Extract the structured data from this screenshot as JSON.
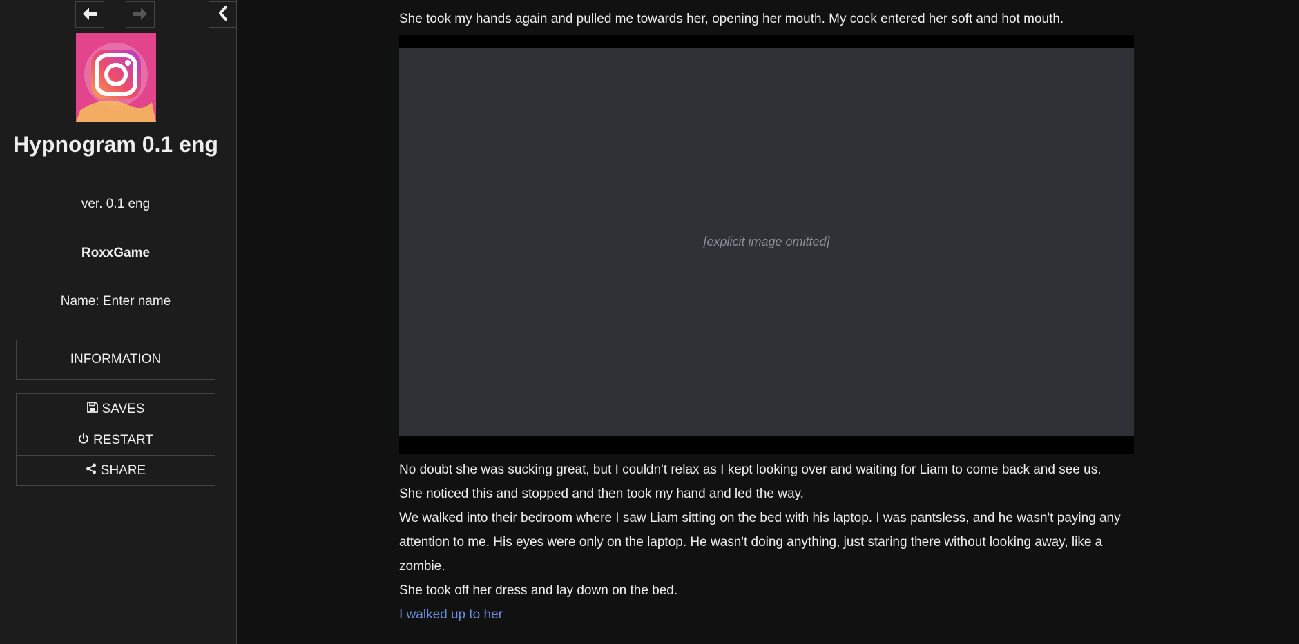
{
  "sidebar": {
    "history_back_icon": "arrow-left-icon",
    "history_forward_icon": "arrow-right-icon",
    "stow_icon": "chevron-left-icon",
    "cover_icon": "instagram-logo-icon",
    "title": "Hypnogram 0.1 eng",
    "version": "ver. 0.1 eng",
    "author": "RoxxGame",
    "name_label": "Name:",
    "name_value": "Enter name",
    "information_label": "INFORMATION",
    "menu": [
      {
        "label": "SAVES",
        "icon": "floppy-disk-icon"
      },
      {
        "label": "RESTART",
        "icon": "power-icon"
      },
      {
        "label": "SHARE",
        "icon": "share-icon"
      }
    ]
  },
  "passage": {
    "intro": "She took my hands again and pulled me towards her, opening her mouth. My cock entered her soft and hot mouth.",
    "image_placeholder": "[explicit image omitted]",
    "paragraphs": [
      "No doubt she was sucking great, but I couldn't relax as I kept looking over and waiting for Liam to come back and see us.",
      "She noticed this and stopped and then took my hand and led the way.",
      "We walked into their bedroom where I saw Liam sitting on the bed with his laptop. I was pantsless, and he wasn't paying any attention to me. His eyes were only on the laptop. He wasn't doing anything, just staring there without looking away, like a zombie.",
      "She took off her dress and lay down on the bed."
    ],
    "continue_link": "I walked up to her"
  },
  "colors": {
    "background": "#111111",
    "sidebar_bg": "#1c1c1c",
    "text": "#eeeeee",
    "link": "#6e8fe0",
    "border": "#444444"
  }
}
